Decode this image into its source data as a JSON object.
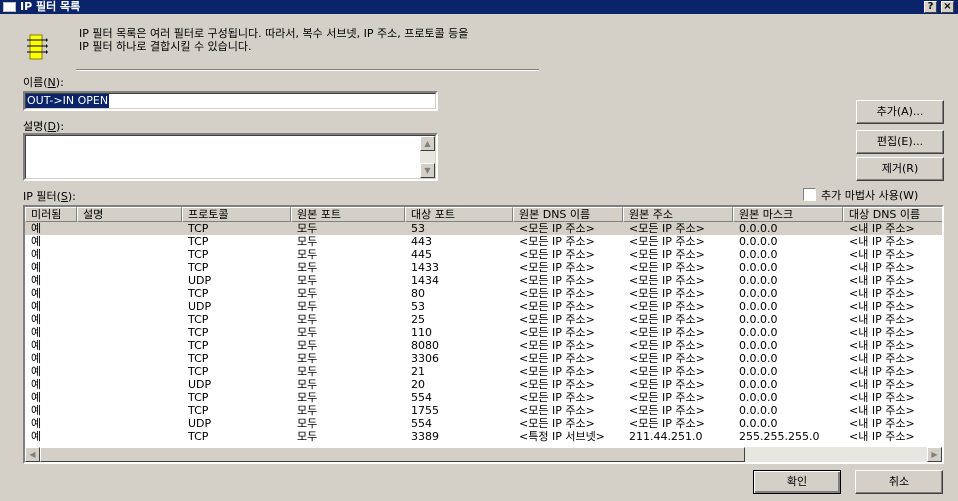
{
  "window": {
    "title": "IP 필터 목록",
    "help_glyph": "?",
    "close_glyph": "×"
  },
  "description": "IP 필터 목록은 여러 필터로 구성됩니다. 따라서, 복수 서브넷, IP 주소, 프로토콜 등을\nIP 필터 하나로 결합시킬 수 있습니다.",
  "name": {
    "label_prefix": "이름(",
    "label_key": "N",
    "label_suffix": "):",
    "value": "OUT->IN OPEN"
  },
  "desc_field": {
    "label_prefix": "설명(",
    "label_key": "D",
    "label_suffix": "):",
    "value": ""
  },
  "filters": {
    "label_prefix": "IP 필터(",
    "label_key": "S",
    "label_suffix": "):"
  },
  "buttons": {
    "add": "추가(A)...",
    "edit": "편집(E)...",
    "remove": "제거(R)",
    "ok": "확인",
    "cancel": "취소"
  },
  "wizard": {
    "label": "추가 마법사 사용(W)",
    "checked": false
  },
  "table": {
    "columns": [
      "미러됨",
      "설명",
      "프로토콜",
      "원본 포트",
      "대상 포트",
      "원본 DNS 이름",
      "원본 주소",
      "원본 마스크",
      "대상 DNS 이름"
    ],
    "rows": [
      [
        "예",
        "",
        "TCP",
        "모두",
        "53",
        "<모든 IP 주소>",
        "<모든 IP 주소>",
        "0.0.0.0",
        "<내 IP 주소>"
      ],
      [
        "예",
        "",
        "TCP",
        "모두",
        "443",
        "<모든 IP 주소>",
        "<모든 IP 주소>",
        "0.0.0.0",
        "<내 IP 주소>"
      ],
      [
        "예",
        "",
        "TCP",
        "모두",
        "445",
        "<모든 IP 주소>",
        "<모든 IP 주소>",
        "0.0.0.0",
        "<내 IP 주소>"
      ],
      [
        "예",
        "",
        "TCP",
        "모두",
        "1433",
        "<모든 IP 주소>",
        "<모든 IP 주소>",
        "0.0.0.0",
        "<내 IP 주소>"
      ],
      [
        "예",
        "",
        "UDP",
        "모두",
        "1434",
        "<모든 IP 주소>",
        "<모든 IP 주소>",
        "0.0.0.0",
        "<내 IP 주소>"
      ],
      [
        "예",
        "",
        "TCP",
        "모두",
        "80",
        "<모든 IP 주소>",
        "<모든 IP 주소>",
        "0.0.0.0",
        "<내 IP 주소>"
      ],
      [
        "예",
        "",
        "UDP",
        "모두",
        "53",
        "<모든 IP 주소>",
        "<모든 IP 주소>",
        "0.0.0.0",
        "<내 IP 주소>"
      ],
      [
        "예",
        "",
        "TCP",
        "모두",
        "25",
        "<모든 IP 주소>",
        "<모든 IP 주소>",
        "0.0.0.0",
        "<내 IP 주소>"
      ],
      [
        "예",
        "",
        "TCP",
        "모두",
        "110",
        "<모든 IP 주소>",
        "<모든 IP 주소>",
        "0.0.0.0",
        "<내 IP 주소>"
      ],
      [
        "예",
        "",
        "TCP",
        "모두",
        "8080",
        "<모든 IP 주소>",
        "<모든 IP 주소>",
        "0.0.0.0",
        "<내 IP 주소>"
      ],
      [
        "예",
        "",
        "TCP",
        "모두",
        "3306",
        "<모든 IP 주소>",
        "<모든 IP 주소>",
        "0.0.0.0",
        "<내 IP 주소>"
      ],
      [
        "예",
        "",
        "TCP",
        "모두",
        "21",
        "<모든 IP 주소>",
        "<모든 IP 주소>",
        "0.0.0.0",
        "<내 IP 주소>"
      ],
      [
        "예",
        "",
        "UDP",
        "모두",
        "20",
        "<모든 IP 주소>",
        "<모든 IP 주소>",
        "0.0.0.0",
        "<내 IP 주소>"
      ],
      [
        "예",
        "",
        "TCP",
        "모두",
        "554",
        "<모든 IP 주소>",
        "<모든 IP 주소>",
        "0.0.0.0",
        "<내 IP 주소>"
      ],
      [
        "예",
        "",
        "TCP",
        "모두",
        "1755",
        "<모든 IP 주소>",
        "<모든 IP 주소>",
        "0.0.0.0",
        "<내 IP 주소>"
      ],
      [
        "예",
        "",
        "UDP",
        "모두",
        "554",
        "<모든 IP 주소>",
        "<모든 IP 주소>",
        "0.0.0.0",
        "<내 IP 주소>"
      ],
      [
        "예",
        "",
        "TCP",
        "모두",
        "3389",
        "<특정 IP 서브넷>",
        "211.44.251.0",
        "255.255.255.0",
        "<내 IP 주소>"
      ]
    ]
  },
  "colors": {
    "title_bar": "#0a246a",
    "face": "#d4d0c8",
    "selection": "#0a246a"
  },
  "icons": {
    "filter_list": "filter-list-icon",
    "scroll_up": "up-arrow-icon",
    "scroll_down": "down-arrow-icon",
    "scroll_left": "left-arrow-icon",
    "scroll_right": "right-arrow-icon"
  }
}
